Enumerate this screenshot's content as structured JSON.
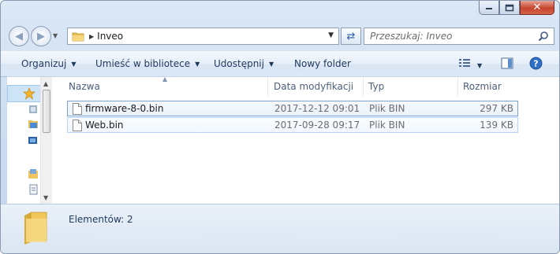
{
  "window": {
    "caption_buttons": {
      "minimize": "minimize-icon",
      "maximize": "maximize-icon",
      "close": "✕"
    }
  },
  "address_bar": {
    "crumb": "Inveo"
  },
  "search": {
    "placeholder": "Przeszukaj: Inveo"
  },
  "toolbar": {
    "organize": "Organizuj",
    "library": "Umieść w bibliotece",
    "share": "Udostępnij",
    "new_folder": "Nowy folder"
  },
  "columns": {
    "name": "Nazwa",
    "date": "Data modyfikacji",
    "type": "Typ",
    "size": "Rozmiar"
  },
  "files": [
    {
      "name": "firmware-8-0.bin",
      "date": "2017-12-12 09:01",
      "type": "Plik BIN",
      "size": "297 KB"
    },
    {
      "name": "Web.bin",
      "date": "2017-09-28 09:17",
      "type": "Plik BIN",
      "size": "139 KB"
    }
  ],
  "details": {
    "count": "Elementów: 2"
  },
  "colors": {
    "accent": "#1e395b",
    "selection_border": "#7da2ce",
    "close_red": "#c7442d"
  }
}
